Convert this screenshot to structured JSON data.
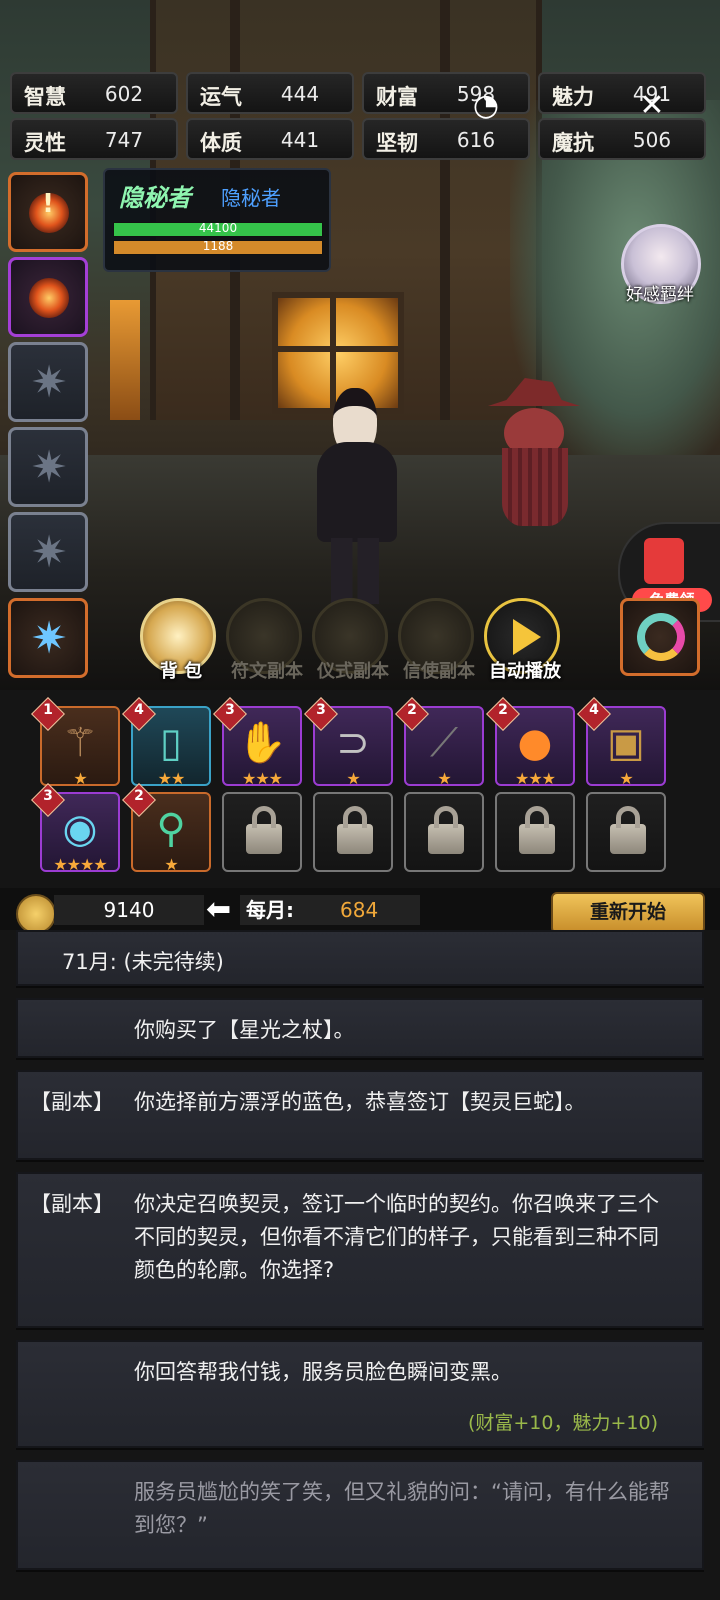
{
  "stats": [
    {
      "name": "智慧",
      "value": "602"
    },
    {
      "name": "运气",
      "value": "444"
    },
    {
      "name": "财富",
      "value": "598"
    },
    {
      "name": "魅力",
      "value": "491"
    },
    {
      "name": "灵性",
      "value": "747"
    },
    {
      "name": "体质",
      "value": "441"
    },
    {
      "name": "坚韧",
      "value": "616"
    },
    {
      "name": "魔抗",
      "value": "506"
    }
  ],
  "hero": {
    "title_art": "隐秘者",
    "class_name": "隐秘者",
    "hp": "44100",
    "mp": "1188",
    "hp_ratio": 1.0,
    "mp_ratio": 1.0
  },
  "side": {
    "affinity_label": "好感羁绊",
    "free_label": "免费领"
  },
  "actions": [
    {
      "label": "背 包",
      "enabled": true
    },
    {
      "label": "符文副本",
      "enabled": false
    },
    {
      "label": "仪式副本",
      "enabled": false
    },
    {
      "label": "信使副本",
      "enabled": false
    },
    {
      "label": "自动播放",
      "enabled": true
    }
  ],
  "inventory": [
    {
      "level": "1",
      "stars": "★",
      "rarity": "orange",
      "icon": "staff-icon"
    },
    {
      "level": "4",
      "stars": "★★",
      "rarity": "blue",
      "icon": "tablet-icon"
    },
    {
      "level": "3",
      "stars": "★★★",
      "rarity": "purple",
      "icon": "glove-icon"
    },
    {
      "level": "3",
      "stars": "★",
      "rarity": "purple",
      "icon": "cane-icon"
    },
    {
      "level": "2",
      "stars": "★",
      "rarity": "purple",
      "icon": "wand-icon"
    },
    {
      "level": "2",
      "stars": "★★★",
      "rarity": "purple",
      "icon": "fire-orb-icon"
    },
    {
      "level": "4",
      "stars": "★",
      "rarity": "purple",
      "icon": "chest-icon"
    },
    {
      "level": "3",
      "stars": "★★★★",
      "rarity": "purple",
      "icon": "crystal-ball-icon"
    },
    {
      "level": "2",
      "stars": "★",
      "rarity": "orange",
      "icon": "scepter-icon"
    }
  ],
  "money": {
    "gold": "9140",
    "monthly_label": "每月:",
    "monthly_value": "684",
    "restart": "重新开始"
  },
  "log": [
    {
      "tag": "",
      "text": "71月: (未完待续)",
      "gain": ""
    },
    {
      "tag": "",
      "text": "你购买了【星光之杖】。",
      "gain": ""
    },
    {
      "tag": "【副本】",
      "text": "你选择前方漂浮的蓝色，恭喜签订【契灵巨蛇】。",
      "gain": ""
    },
    {
      "tag": "【副本】",
      "text": "你决定召唤契灵，签订一个临时的契约。你召唤来了三个不同的契灵，但你看不清它们的样子，只能看到三种不同颜色的轮廓。你选择?",
      "gain": ""
    },
    {
      "tag": "",
      "text": "你回答帮我付钱，服务员脸色瞬间变黑。",
      "gain": "(财富+10，魅力+10)"
    },
    {
      "tag": "",
      "text": "服务员尴尬的笑了笑，但又礼貌的问：“请问，有什么能帮到您？”",
      "gain": ""
    }
  ],
  "colors": {
    "orange": "#c96a2b",
    "purple": "#9b3cd2",
    "blue": "#3aa2c7",
    "gain": "#9ab94a",
    "gold": "#f0a83a"
  }
}
